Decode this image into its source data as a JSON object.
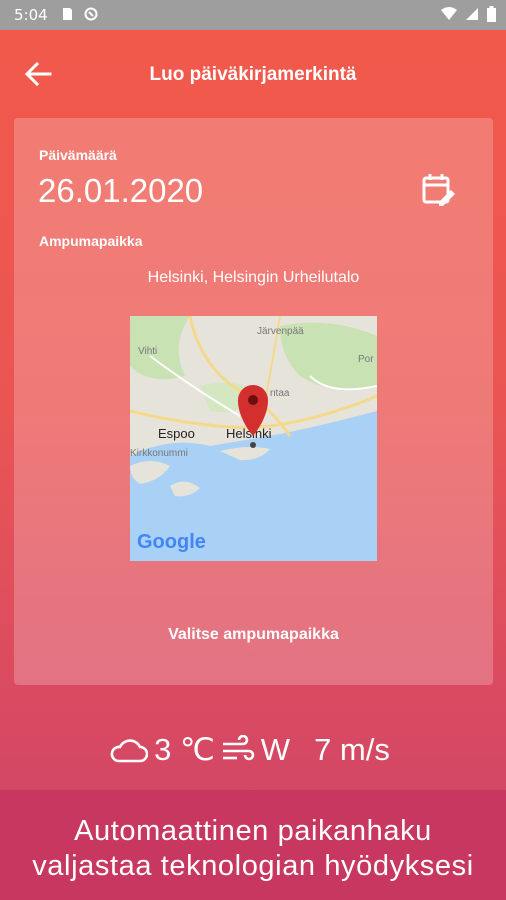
{
  "status": {
    "time": "5:04"
  },
  "appbar": {
    "title": "Luo päiväkirjamerkintä"
  },
  "form": {
    "date_label": "Päivämäärä",
    "date_value": "26.01.2020",
    "place_label": "Ampumapaikka",
    "place_value": "Helsinki, Helsingin Urheilutalo",
    "select_place_label": "Valitse ampumapaikka"
  },
  "map": {
    "labels": {
      "jarvenpaa": "Järvenpää",
      "vantaa": "ntaa",
      "espoo": "Espoo",
      "helsinki": "Helsinki",
      "kirkkonummi": "Kirkkonummi",
      "vihti": "Vihti",
      "porvoo": "Por"
    },
    "logo": "Google"
  },
  "weather": {
    "temperature": "3 ℃",
    "wind_direction": "W",
    "wind_speed": "7 m/s"
  },
  "caption": {
    "line1": "Automaattinen paikanhaku",
    "line2": "valjastaa teknologian hyödyksesi"
  },
  "colors": {
    "accent_top": "#f25a4a",
    "accent_bottom": "#c8436a",
    "caption_bg": "#c7375f",
    "status_bar": "#9e9e9e",
    "pin": "#d32f2f"
  }
}
